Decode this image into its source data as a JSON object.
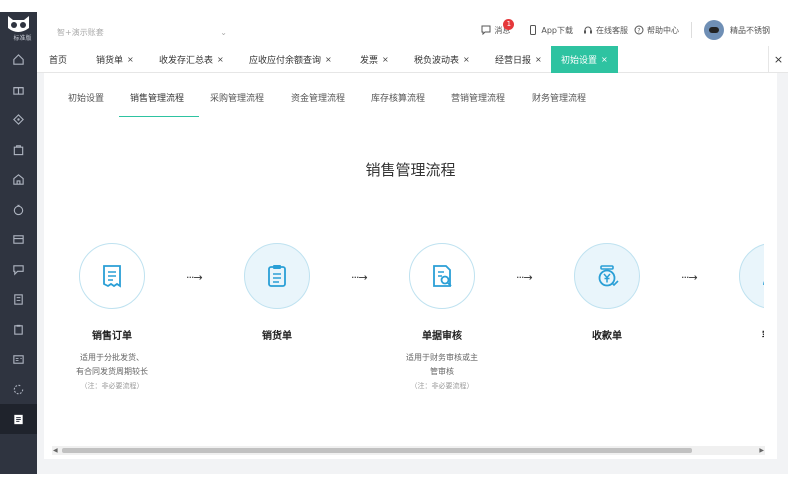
{
  "sidebar": {
    "logo_text": "标准版",
    "items": [
      "home-icon",
      "gift-icon",
      "tag-icon",
      "bag-icon",
      "house-icon",
      "money-bag-icon",
      "card-icon",
      "chat-icon",
      "building-icon",
      "clipboard-icon",
      "id-card-icon",
      "refresh-icon",
      "document-icon"
    ]
  },
  "header": {
    "account": "智+演示账套",
    "message_label": "消息",
    "message_count": "1",
    "app_label": "App下载",
    "service_label": "在线客服",
    "help_label": "帮助中心",
    "user_name": "精品不锈钢"
  },
  "tabs": [
    {
      "label": "首页",
      "closable": false
    },
    {
      "label": "销货单",
      "closable": true
    },
    {
      "label": "收发存汇总表",
      "closable": true
    },
    {
      "label": "应收应付余额查询",
      "closable": true
    },
    {
      "label": "发票",
      "closable": true
    },
    {
      "label": "税负波动表",
      "closable": true
    },
    {
      "label": "经营日报",
      "closable": true
    },
    {
      "label": "初始设置",
      "closable": true,
      "active": true
    }
  ],
  "close_symbol": "×",
  "subtabs": [
    "初始设置",
    "销售管理流程",
    "采购管理流程",
    "资金管理流程",
    "库存核算流程",
    "营销管理流程",
    "财务管理流程"
  ],
  "active_subtab": "销售管理流程",
  "page_title": "销售管理流程",
  "arrow_symbol": "···→",
  "flow_steps": [
    {
      "title": "销售订单",
      "desc1": "适用于分批发货、",
      "desc2": "有合同发货周期较长",
      "note": "（注：非必要流程）"
    },
    {
      "title": "销货单"
    },
    {
      "title": "单据审核",
      "desc1": "适用于财务审核或主",
      "desc2": "管审核",
      "note": "（注：非必要流程）"
    },
    {
      "title": "收款单"
    },
    {
      "title": "客户"
    }
  ],
  "colors": {
    "accent": "#2ec3a1",
    "sidebar": "#2f3440",
    "icon_blue": "#2a9fd6",
    "badge": "#e5383b"
  }
}
